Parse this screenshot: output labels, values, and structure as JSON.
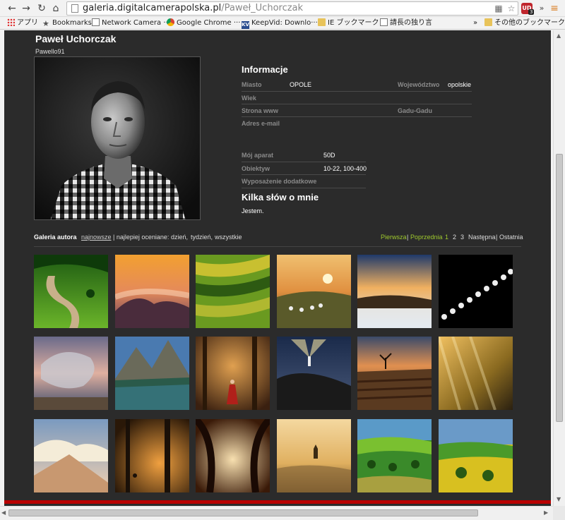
{
  "browser": {
    "url_host": "galeria.digitalcamerapolska.pl",
    "url_path": "/Paweł_Uchorczak",
    "bookmarks": [
      {
        "label": "アプリ",
        "icon": "apps-icon"
      },
      {
        "label": "Bookmarks",
        "icon": "star-icon"
      },
      {
        "label": "Network Camera ···",
        "icon": "page-icon"
      },
      {
        "label": "Google Chrome ···",
        "icon": "chrome-icon"
      },
      {
        "label": "KeepVid: Downlo···",
        "icon": "keepvid-icon"
      },
      {
        "label": "IE ブックマーク",
        "icon": "folder-icon"
      },
      {
        "label": "請長の独り言",
        "icon": "page-icon"
      }
    ],
    "more_bookmarks": "»",
    "other_bookmarks": "その他のブックマーク",
    "ext_badge": "3",
    "ext_label": "UD"
  },
  "profile": {
    "name": "Paweł Uchorczak",
    "username": "Pawello91"
  },
  "info": {
    "heading": "Informacje",
    "miasto_label": "Miasto",
    "miasto_value": "OPOLE",
    "woj_label": "Województwo",
    "woj_value": "opolskie",
    "wiek_label": "Wiek",
    "www_label": "Strona www",
    "gg_label": "Gadu-Gadu",
    "email_label": "Adres e-mail",
    "aparat_label": "Mój aparat",
    "aparat_value": "50D",
    "obiektyw_label": "Obiektyw",
    "obiektyw_value": "10-22, 100-400",
    "wyposazenie_label": "Wyposażenie dodatkowe"
  },
  "about": {
    "heading": "Kilka słów o mnie",
    "text": "Jestem."
  },
  "gallery": {
    "title": "Galeria autora",
    "newest": "najnowsze",
    "best_prefix": "| najlepiej oceniane:",
    "day": "dzień,",
    "week": "tydzień,",
    "all": "wszystkie",
    "first": "Pierwsza",
    "divider": "|",
    "prev": "Poprzednia",
    "page1": "1",
    "page2": "2",
    "page3": "3",
    "next": "Następna",
    "last": "Ostatnia"
  }
}
